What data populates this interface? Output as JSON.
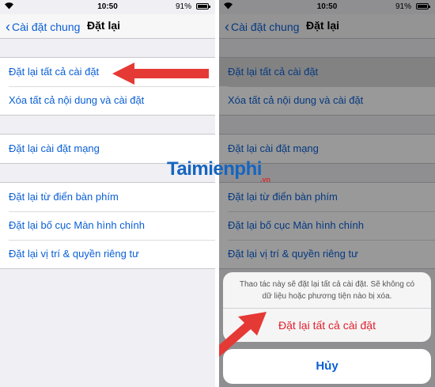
{
  "status_bar": {
    "time": "10:50",
    "battery": "91%"
  },
  "nav": {
    "back_label": "Cài đặt chung",
    "title": "Đặt lại"
  },
  "groups": [
    [
      "Đặt lại tất cả cài đặt",
      "Xóa tất cả nội dung và cài đặt"
    ],
    [
      "Đặt lại cài đặt mạng"
    ],
    [
      "Đặt lại từ điển bàn phím",
      "Đặt lại bố cục Màn hình chính",
      "Đặt lại vị trí & quyền riêng tư"
    ]
  ],
  "action_sheet": {
    "message": "Thao tác này sẽ đặt lại tất cả cài đặt. Sẽ không có dữ liệu hoặc phương tiện nào bị xóa.",
    "destructive_label": "Đặt lại tất cả cài đặt",
    "cancel_label": "Hủy"
  },
  "watermark": {
    "text": "Taimienphi",
    "sub": ".vn"
  },
  "colors": {
    "link_blue": "#0a5fd6",
    "destructive_red": "#e0212e",
    "arrow_red": "#e53935",
    "group_bg": "#efeff4"
  },
  "icons": [
    "wifi-icon",
    "battery-icon",
    "chevron-left-icon",
    "arrow-annotation"
  ]
}
